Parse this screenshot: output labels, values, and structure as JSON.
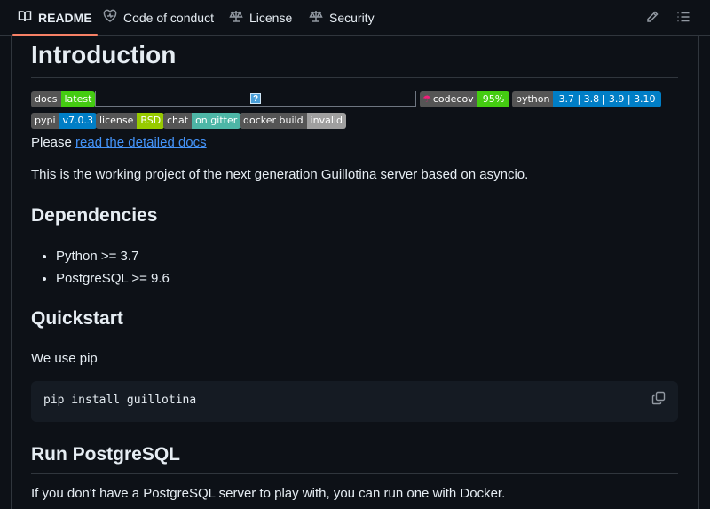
{
  "tabs": [
    {
      "label": "README",
      "icon": "book-icon",
      "active": true
    },
    {
      "label": "Code of conduct",
      "icon": "heart-icon"
    },
    {
      "label": "License",
      "icon": "scale-icon"
    },
    {
      "label": "Security",
      "icon": "scale-icon"
    }
  ],
  "toolbar": {
    "edit_icon": "pencil-icon",
    "toc_icon": "list-icon"
  },
  "heading": "Introduction",
  "badges": {
    "docs": {
      "left": "docs",
      "right": "latest",
      "color": "#4c1"
    },
    "codecov": {
      "left": "codecov",
      "right": "95%",
      "color": "#4c1"
    },
    "python": {
      "left": "python",
      "right": "3.7 | 3.8 | 3.9 | 3.10",
      "color": "#007ec6"
    },
    "pypi": {
      "left": "pypi",
      "right": "v7.0.3",
      "color": "#007ec6"
    },
    "license": {
      "left": "license",
      "right": "BSD",
      "color": "#97ca00"
    },
    "chat": {
      "left": "chat",
      "right": "on gitter",
      "color": "#4db6a6"
    },
    "docker": {
      "left": "docker build",
      "right": "invalid",
      "color": "#9f9f9f"
    }
  },
  "intro": {
    "please": "Please ",
    "docs_link": "read the detailed docs",
    "description": "This is the working project of the next generation Guillotina server based on asyncio."
  },
  "dependencies": {
    "heading": "Dependencies",
    "items": [
      "Python >= 3.7",
      "PostgreSQL >= 9.6"
    ]
  },
  "quickstart": {
    "heading": "Quickstart",
    "text": "We use pip",
    "code": "pip install guillotina"
  },
  "postgres": {
    "heading": "Run PostgreSQL",
    "text": "If you don't have a PostgreSQL server to play with, you can run one with Docker."
  }
}
